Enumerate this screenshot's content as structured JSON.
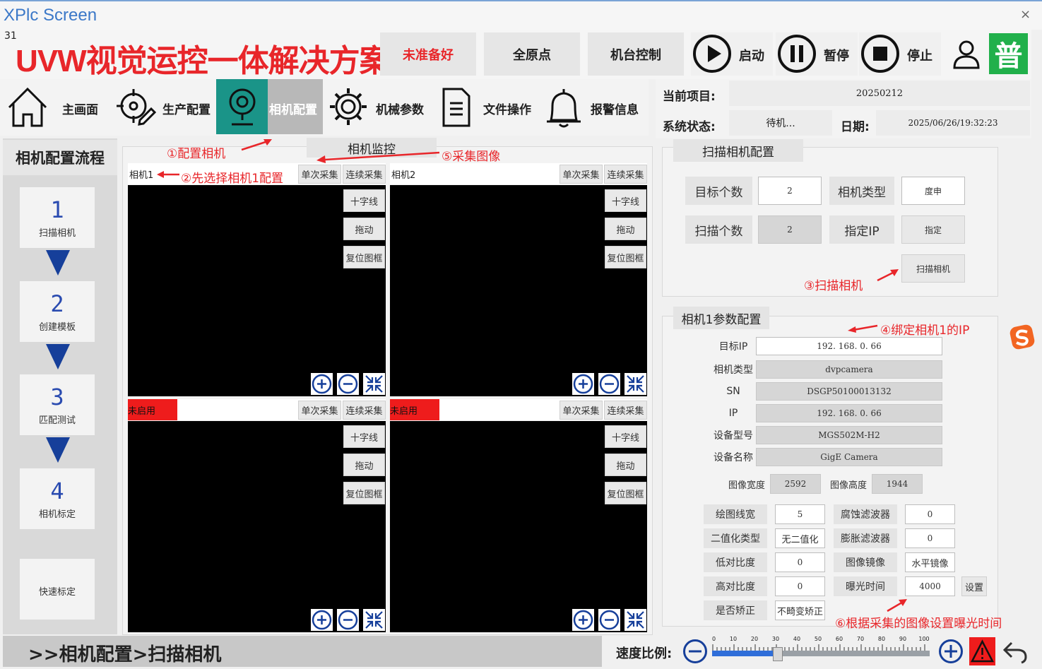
{
  "window": {
    "title": "XPlc Screen",
    "close_glyph": "×"
  },
  "header": {
    "version": "31",
    "app_title": "UVW视觉运控一体解决方案",
    "status_button": "未准备好",
    "home_all_button": "全原点",
    "machine_control_button": "机台控制",
    "start_label": "启动",
    "pause_label": "暂停",
    "stop_label": "停止",
    "user_level": "普"
  },
  "nav": {
    "items": [
      {
        "label": "主画面",
        "icon": "home-icon"
      },
      {
        "label": "生产配置",
        "icon": "crosshair-pen-icon"
      },
      {
        "label": "相机配置",
        "icon": "camera-icon",
        "active": true
      },
      {
        "label": "机械参数",
        "icon": "gear-icon"
      },
      {
        "label": "文件操作",
        "icon": "document-icon"
      },
      {
        "label": "报警信息",
        "icon": "bell-icon"
      }
    ]
  },
  "info": {
    "project_label": "当前项目:",
    "project_value": "20250212",
    "status_label": "系统状态:",
    "status_value": "待机...",
    "date_label": "日期:",
    "date_value": "2025/06/26/19:32:23"
  },
  "flow": {
    "title": "相机配置流程",
    "steps": [
      {
        "num": "1",
        "label": "扫描相机"
      },
      {
        "num": "2",
        "label": "创建模板"
      },
      {
        "num": "3",
        "label": "匹配测试"
      },
      {
        "num": "4",
        "label": "相机标定"
      }
    ],
    "quick_label": "快速标定"
  },
  "monitor": {
    "tab_label": "相机监控",
    "single_capture": "单次采集",
    "continuous_capture": "连续采集",
    "crosshair": "十字线",
    "drag": "拖动",
    "reset_frame": "复位图框",
    "cam1_label": "相机1",
    "cam2_label": "相机2",
    "disabled_label": "未启用"
  },
  "annotations": {
    "a1": "①配置相机",
    "a2": "②先选择相机1配置",
    "a3": "③扫描相机",
    "a4": "④绑定相机1的IP",
    "a5": "⑤采集图像",
    "a6": "⑥根据采集的图像设置曝光时间"
  },
  "scan": {
    "title": "扫描相机配置",
    "target_count_label": "目标个数",
    "target_count_value": "2",
    "camera_type_label": "相机类型",
    "camera_type_value": "度申",
    "scan_count_label": "扫描个数",
    "scan_count_value": "2",
    "assign_ip_label": "指定IP",
    "assign_button": "指定",
    "scan_button": "扫描相机"
  },
  "params": {
    "title": "相机1参数配置",
    "target_ip_label": "目标IP",
    "target_ip_value": "192. 168. 0. 66",
    "camera_type_label": "相机类型",
    "camera_type_value": "dvpcamera",
    "sn_label": "SN",
    "sn_value": "DSGP50100013132",
    "ip_label": "IP",
    "ip_value": "192. 168. 0. 66",
    "model_label": "设备型号",
    "model_value": "MGS502M-H2",
    "name_label": "设备名称",
    "name_value": "GigE Camera",
    "width_label": "图像宽度",
    "width_value": "2592",
    "height_label": "图像高度",
    "height_value": "1944",
    "line_width_label": "绘图线宽",
    "line_width_value": "5",
    "erode_label": "腐蚀滤波器",
    "erode_value": "0",
    "binarize_label": "二值化类型",
    "binarize_value": "无二值化",
    "dilate_label": "膨胀滤波器",
    "dilate_value": "0",
    "low_contrast_label": "低对比度",
    "low_contrast_value": "0",
    "mirror_label": "图像镜像",
    "mirror_value": "水平镜像",
    "high_contrast_label": "高对比度",
    "high_contrast_value": "0",
    "exposure_label": "曝光时间",
    "exposure_value": "4000",
    "set_button": "设置",
    "correct_label": "是否矫正",
    "correct_value": "不畸变矫正"
  },
  "footer": {
    "breadcrumb": ">>相机配置>扫描相机",
    "speed_label": "速度比例:",
    "speed_ticks": [
      "0",
      "10",
      "20",
      "30",
      "40",
      "50",
      "60",
      "70",
      "80",
      "90",
      "100"
    ],
    "speed_value": 30
  },
  "colors": {
    "title_red": "#e8262a",
    "accent_teal": "#1a9488",
    "nav_blue": "#163f9a",
    "user_green": "#21b04b",
    "alarm_red": "#ee1c1c"
  }
}
